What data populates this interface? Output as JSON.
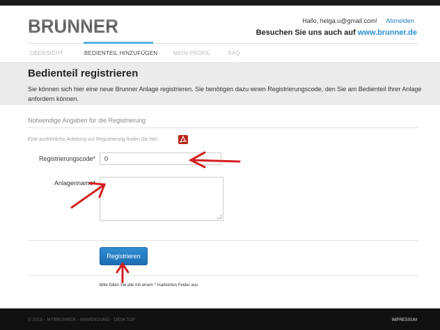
{
  "header": {
    "logo_text": "BRUNNER",
    "greeting": "Hallo, helga.u@gmail.com!",
    "logout": "Abmelden",
    "visit_prefix": "Besuchen Sie uns auch auf",
    "visit_url": "www.brunner.de"
  },
  "nav": {
    "items": [
      "ÜBERSICHT",
      "BEDIENTEIL HINZUFÜGEN",
      "MEIN PROFIL",
      "FAQ"
    ],
    "active_index": 1
  },
  "page": {
    "title": "Bedienteil registrieren",
    "intro": "Sie können sich hier eine neue Brunner Anlage registrieren. Sie benötigen dazu einen Registrierungscode, den Sie am Bedienteil Ihrer Anlage anfordern können."
  },
  "form": {
    "section_title": "Notwendige Angaben für die Registrierung",
    "anleitung": "Eine ausführliche Anleitung zur Registrierung finden Sie hier:",
    "pdf_icon": "pdf-icon",
    "code_label": "Registrierungscode*",
    "code_value": "0",
    "name_label": "Anlagenname*",
    "name_value": "",
    "submit": "Registrieren",
    "hint": "Bitte füllen Sie alle mit einem * markierten Felder aus."
  },
  "footer": {
    "copyright": "© 2015 - MYBRUNNER - ANWENDUNG - DESKTOP",
    "impressum": "IMPRESSUM"
  },
  "colors": {
    "accent": "#2a8fd0",
    "annotation_arrow": "#d41f1f",
    "button": "#2f8dd3"
  }
}
